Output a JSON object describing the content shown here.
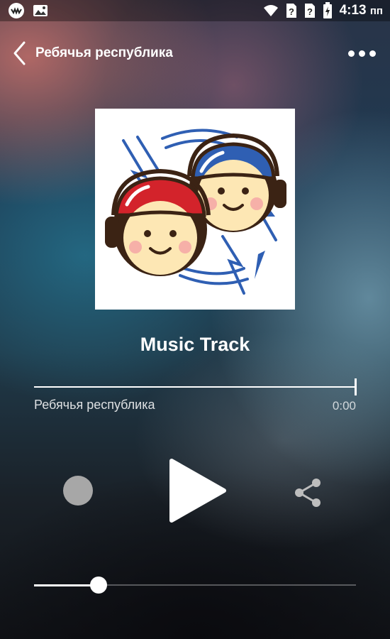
{
  "status_bar": {
    "time": "4:13",
    "time_suffix": "пп",
    "icons": [
      "app-logo-icon",
      "image-icon",
      "wifi-icon",
      "no-sim-icon",
      "no-sim-icon",
      "battery-charging-icon"
    ]
  },
  "header": {
    "title": "Ребячья республика"
  },
  "track": {
    "title": "Music Track",
    "artist": "Ребячья республика",
    "time": "0:00",
    "progress": 1.0
  },
  "controls": {
    "record_icon": "record-icon",
    "play_icon": "play-icon",
    "share_icon": "share-icon"
  },
  "volume": {
    "level": 0.2
  },
  "colors": {
    "accent": "#ffffff",
    "record_button": "#a7a7a7",
    "logo_red": "#d3232b",
    "logo_blue": "#2f5fb3",
    "face": "#fde7b4"
  }
}
